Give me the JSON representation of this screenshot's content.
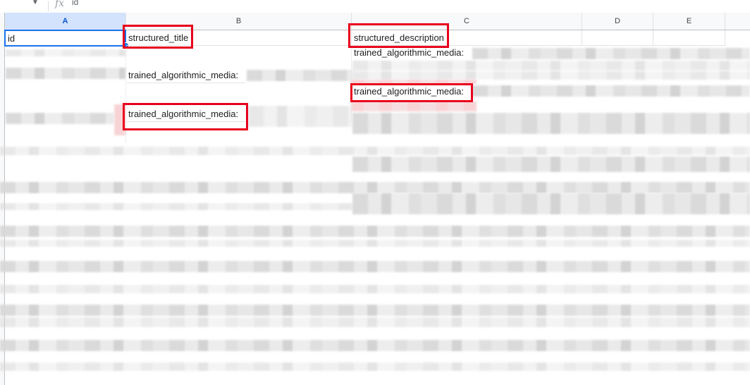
{
  "formula_bar": {
    "fx_label": "fx",
    "value": "id"
  },
  "columns": [
    "A",
    "B",
    "C",
    "D",
    "E"
  ],
  "header_row": {
    "a": "id",
    "b": "structured_title",
    "c": "structured_description"
  },
  "cells": {
    "c_row2": "trained_algorithmic_media:",
    "b_row3": "trained_algorithmic_media:",
    "c_row4": "trained_algorithmic_media:",
    "b_row5": "trained_algorithmic_media:"
  },
  "colors": {
    "highlight_box": "#e8001c",
    "selection": "#1a73e8",
    "selected_header_bg": "#d3e3fd"
  }
}
